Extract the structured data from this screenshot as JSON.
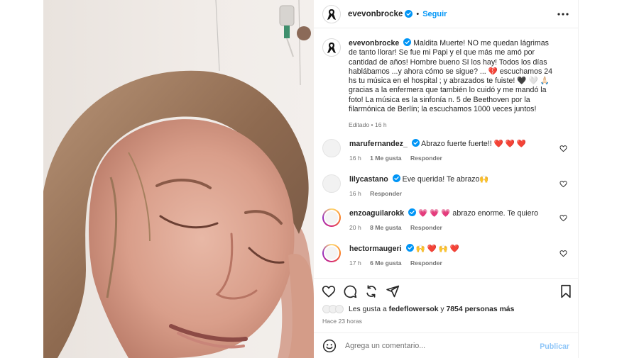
{
  "post": {
    "author": "evevonbrocke",
    "follow_label": "Seguir",
    "separator": "•",
    "caption_text": "Maldita Muerte! NO me quedan lágrimas de tanto llorar! Se fue mi Papi y el que más me amó por cantidad de años! Hombre bueno SI los hay! Todos los días hablábamos ...y ahora cómo se sigue? ... 💔 escuchamos 24 hs tu música en el hospital ; y abrazados te fuiste! 🖤 🤍 🙏🏻 gracias a la enfermera que también lo cuidó y me mandó la foto! La música es la sinfonía n. 5 de Beethoven por la filarmónica de Berlín; la escuchamos 1000 veces juntos!",
    "edited_label": "Editado",
    "edited_time": "16 h"
  },
  "comments": [
    {
      "user": "marufernandez_",
      "text": "Abrazo fuerte fuerte!! ❤️ ❤️ ❤️",
      "time": "16 h",
      "likes": "1 Me gusta",
      "reply": "Responder"
    },
    {
      "user": "lilycastano",
      "text": "Eve querida! Te abrazo🙌",
      "time": "16 h",
      "likes": "",
      "reply": "Responder"
    },
    {
      "user": "enzoaguilarokk",
      "text": "💗 💗 💗 abrazo enorme. Te quiero",
      "time": "20 h",
      "likes": "8 Me gusta",
      "reply": "Responder"
    },
    {
      "user": "hectormaugeri",
      "text": "🙌 ❤️ 🙌 ❤️",
      "time": "17 h",
      "likes": "6 Me gusta",
      "reply": "Responder"
    }
  ],
  "likes": {
    "prefix": "Les gusta a",
    "user": "fedeflowersok",
    "connector": "y",
    "count": "7854 personas más"
  },
  "posted_ago": "Hace 23 horas",
  "composer": {
    "placeholder": "Agrega un comentario...",
    "publish_label": "Publicar"
  },
  "colors": {
    "link_blue": "#0095f6",
    "verified_blue": "#0095f6",
    "muted_text": "#737373",
    "publish_disabled": "#8fc6f8"
  },
  "icons": [
    "mourning-ribbon-icon",
    "verified-badge-icon",
    "more-options-icon",
    "heart-icon",
    "comment-icon",
    "repost-icon",
    "share-icon",
    "save-icon",
    "emoji-icon"
  ]
}
